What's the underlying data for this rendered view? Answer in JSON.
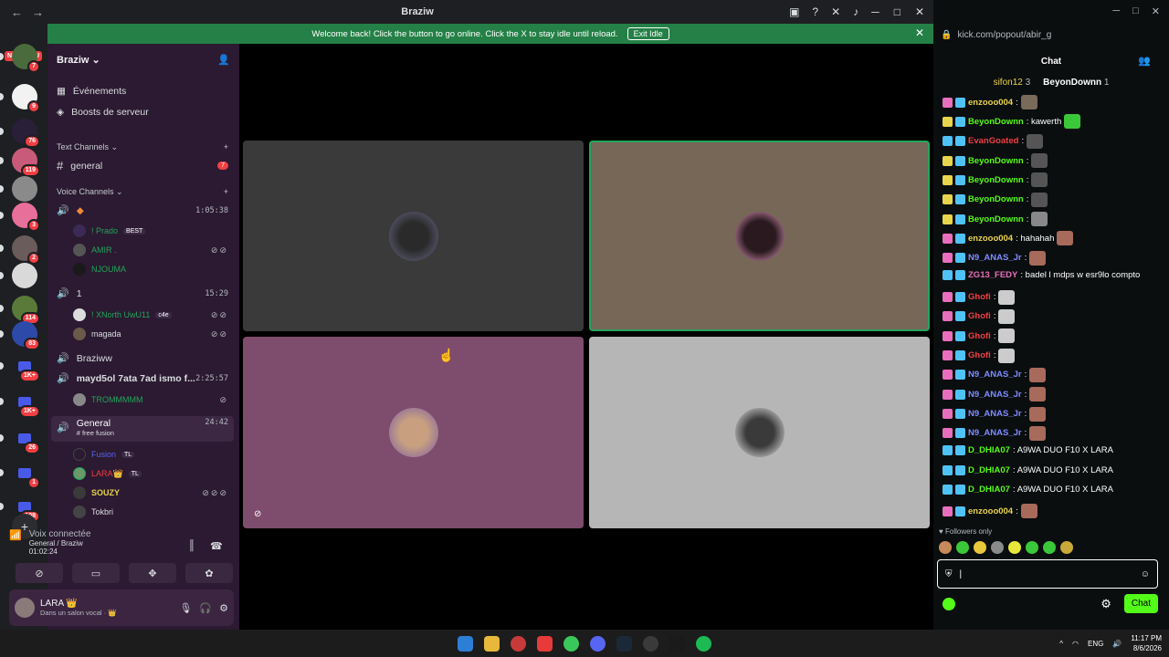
{
  "window": {
    "title": "Braziw"
  },
  "rail": {
    "nouveau": "NOUVEAU",
    "servers": [
      {
        "name": "server-1",
        "badge": "7",
        "color": "#4a6b3c"
      },
      {
        "name": "server-2",
        "badge": "9",
        "color": "#f2f2f2"
      },
      {
        "name": "server-3",
        "badge": "76",
        "color": "#2a1f38"
      },
      {
        "name": "server-4",
        "badge": "119",
        "color": "#c95a7a"
      },
      {
        "name": "server-5",
        "badge": "",
        "color": "#8a8a8a"
      },
      {
        "name": "server-6",
        "badge": "3",
        "color": "#e86f9a"
      },
      {
        "name": "server-7",
        "badge": "2",
        "color": "#6b5c5c"
      },
      {
        "name": "server-8",
        "badge": "",
        "color": "#d9d9d9"
      },
      {
        "name": "server-9",
        "badge": "114",
        "color": "#5a7a3a"
      },
      {
        "name": "server-10",
        "badge": "83",
        "color": "#2e4aa8"
      },
      {
        "name": "folder-1",
        "badge": "1K+",
        "color": "#4a5ae8"
      },
      {
        "name": "folder-2",
        "badge": "1K+",
        "color": "#4a5ae8"
      },
      {
        "name": "folder-3",
        "badge": "26",
        "color": "#4a5ae8"
      },
      {
        "name": "folder-4",
        "badge": "1",
        "color": "#4a5ae8"
      },
      {
        "name": "folder-5",
        "badge": "108",
        "color": "#4a5ae8"
      }
    ],
    "add_label": "+"
  },
  "banner": {
    "text": "Welcome back! Click the button to go online. Click the X to stay idle until reload.",
    "button": "Exit Idle",
    "close": "✕"
  },
  "sidebar": {
    "server_name": "Braziw",
    "events": "Événements",
    "boosts": "Boosts de serveur",
    "text_category": "Text Channels",
    "general_text": "general",
    "general_badge": "7",
    "voice_category": "Voice Channels",
    "voice_channels": [
      {
        "name": "",
        "time": "1:05:38"
      },
      {
        "name": "1",
        "time": "15:29"
      },
      {
        "name": "Braziww",
        "time": ""
      },
      {
        "name": "mayd5ol 7ata 7ad ismo f...",
        "time": "2:25:57"
      },
      {
        "name": "General",
        "time": "24:42",
        "sub": "# free fusion"
      }
    ],
    "users": [
      {
        "name": "! Prado",
        "tag": "BEST",
        "color": "#23a55a"
      },
      {
        "name": "AMIR .",
        "tag": "",
        "color": "#23a55a"
      },
      {
        "name": "NJOUMA",
        "tag": "",
        "color": "#23a55a"
      },
      {
        "name": "! XNorth UwU11",
        "tag": "c4e",
        "color": "#23a55a"
      },
      {
        "name": "magada",
        "tag": "",
        "color": "#dbdee1"
      },
      {
        "name": "TROMMMMM",
        "tag": "",
        "color": "#23a55a"
      },
      {
        "name": "Fusion",
        "tag": "TL",
        "color": "#5865f2"
      },
      {
        "name": "LARA👑",
        "tag": "TL",
        "color": "#f23f43"
      },
      {
        "name": "SOUZY",
        "tag": "",
        "color": "#e8d44d"
      },
      {
        "name": "Tokbri",
        "tag": "",
        "color": "#dbdee1"
      }
    ]
  },
  "voice_panel": {
    "status": "Voix connectée",
    "location": "General / Braziw",
    "elapsed": "01:02:24"
  },
  "userbar": {
    "name": "LARA 👑",
    "status": "Dans un salon vocal · 👑"
  },
  "kick": {
    "url": "kick.com/popout/abir_g",
    "header": "Chat",
    "pinned": [
      {
        "name": "sifon12",
        "count": "3"
      },
      {
        "name": "BeyonDownn",
        "count": "1"
      }
    ],
    "messages": [
      {
        "user": "enzooo004",
        "text": ":",
        "color": "#e8d44d",
        "b": "#e86fbd"
      },
      {
        "user": "BeyonDownn",
        "text": ": kawerth",
        "color": "#53fc18",
        "b": "#e8d44d"
      },
      {
        "user": "EvanGoated",
        "text": ":",
        "color": "#f23f43",
        "b": "#4fc3f7"
      },
      {
        "user": "BeyonDownn",
        "text": ":",
        "color": "#53fc18",
        "b": "#e8d44d"
      },
      {
        "user": "BeyonDownn",
        "text": ":",
        "color": "#53fc18",
        "b": "#e8d44d"
      },
      {
        "user": "BeyonDownn",
        "text": ":",
        "color": "#53fc18",
        "b": "#e8d44d"
      },
      {
        "user": "BeyonDownn",
        "text": ":",
        "color": "#53fc18",
        "b": "#e8d44d"
      },
      {
        "user": "enzooo004",
        "text": ": hahahah",
        "color": "#e8d44d",
        "b": "#e86fbd"
      },
      {
        "user": "N9_ANAS_Jr",
        "text": ":",
        "color": "#7f8cff",
        "b": "#e86fbd"
      },
      {
        "user": "ZG13_FEDY",
        "text": ": badel l mdps w esr9lo compto",
        "color": "#e86fbd",
        "b": "#4fc3f7"
      },
      {
        "user": "Ghofi",
        "text": ":",
        "color": "#f23f43",
        "b": "#e86fbd"
      },
      {
        "user": "Ghofi",
        "text": ":",
        "color": "#f23f43",
        "b": "#e86fbd"
      },
      {
        "user": "Ghofi",
        "text": ":",
        "color": "#f23f43",
        "b": "#e86fbd"
      },
      {
        "user": "Ghofi",
        "text": ":",
        "color": "#f23f43",
        "b": "#e86fbd"
      },
      {
        "user": "N9_ANAS_Jr",
        "text": ":",
        "color": "#7f8cff",
        "b": "#e86fbd"
      },
      {
        "user": "N9_ANAS_Jr",
        "text": ":",
        "color": "#7f8cff",
        "b": "#e86fbd"
      },
      {
        "user": "N9_ANAS_Jr",
        "text": ":",
        "color": "#7f8cff",
        "b": "#e86fbd"
      },
      {
        "user": "N9_ANAS_Jr",
        "text": ":",
        "color": "#7f8cff",
        "b": "#e86fbd"
      },
      {
        "user": "D_DHIA07",
        "text": ": A9WA DUO F10 X LARA",
        "color": "#53fc18",
        "b": "#4fc3f7"
      },
      {
        "user": "D_DHIA07",
        "text": ": A9WA DUO F10 X LARA",
        "color": "#53fc18",
        "b": "#4fc3f7"
      },
      {
        "user": "D_DHIA07",
        "text": ": A9WA DUO F10 X LARA",
        "color": "#53fc18",
        "b": "#4fc3f7"
      },
      {
        "user": "enzooo004",
        "text": ":",
        "color": "#e8d44d",
        "b": "#e86fbd"
      }
    ],
    "followers_only": "Followers only",
    "chat_button": "Chat"
  },
  "taskbar": {
    "lang": "ENG",
    "time": "11:17 PM",
    "date": "8/6/2026"
  }
}
